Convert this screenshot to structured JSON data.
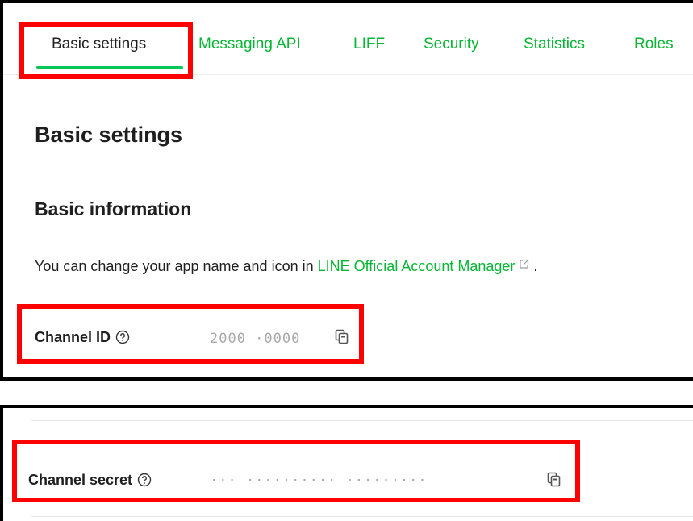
{
  "tabs": [
    {
      "label": "Basic settings",
      "active": true
    },
    {
      "label": "Messaging API",
      "active": false
    },
    {
      "label": "LIFF",
      "active": false
    },
    {
      "label": "Security",
      "active": false
    },
    {
      "label": "Statistics",
      "active": false
    },
    {
      "label": "Roles",
      "active": false
    }
  ],
  "page_title": "Basic settings",
  "section_title": "Basic information",
  "description": {
    "prefix": "You can change your app name and icon in ",
    "link": "LINE Official Account Manager",
    "suffix": " ."
  },
  "fields": {
    "channel_id": {
      "label": "Channel ID",
      "value_masked": "2000 ·0000"
    },
    "channel_secret": {
      "label": "Channel secret",
      "value_masked": "··· ·········· ·········"
    }
  },
  "colors": {
    "accent": "#06c755",
    "link": "#06b634",
    "highlight": "#ff0000"
  },
  "icons": {
    "help": "question-circle-icon",
    "copy": "copy-icon",
    "external": "external-link-icon"
  }
}
